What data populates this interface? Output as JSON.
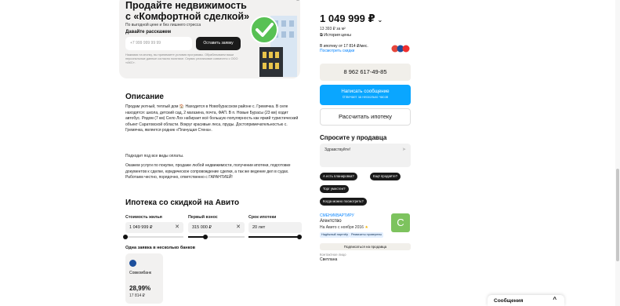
{
  "promo": {
    "title": "Продайте недвижимость с «Комфортной сделкой»",
    "subtitle": "По выгодной цене и без лишнего стресса",
    "cta": "Давайте расскажем",
    "phone_placeholder": "+7 999 999 99 99",
    "submit": "Оставить заявку",
    "legal": "Нажимая на кнопку, вы принимаете условия программы. Обрабатываем ваши персональные данные согласно политике. Сервис реализован совместно с ООО «АКС»."
  },
  "description": {
    "title": "Описание",
    "p1": "Продам уютный, теплый дом 🏠 Находится в Новобурасском районе с. Гремячка. В селе находятся: школа, детский сад, 2 магазина, почта, ФАП. В п. Новые Бурасы (23 км) ходит автобус. Рядом (7 км) Село Лох набирает всё большую популярность как яркий туристический объект Саратовской области. Вокруг красивые леса, пруды. Достопримечательностью с. Гремячка, является родник «Плачущая Стена».",
    "p2": "Подходит под все виды оплаты.",
    "p3": "Окажем услуги по покупке, продаже любой недвижимости, получении ипотеки, подготовке документов к сделке, юридическое сопровождение сделки, а так же ведение дел в судах. Работаем честно, порядочно, ответственно с ГАРАНТИЕЙ!"
  },
  "calculator": {
    "title": "Ипотека со скидкой на Авито",
    "price_label": "Стоимость жилья",
    "price_value": "1 049 999 ₽",
    "down_label": "Первый взнос",
    "down_value": "315 000 ₽",
    "term_label": "Срок ипотеки",
    "term_value": "20 лет",
    "price_slider": 0.0,
    "down_slider": 0.3,
    "term_slider": 0.95,
    "banks_title": "Одна заявка в несколько банков",
    "bank": {
      "name": "Совкомбанк",
      "rate": "28,99%",
      "payment": "17 814 ₽"
    }
  },
  "sidebar": {
    "price": "1 049 999 ₽",
    "price_per_m2": "13 393 ₽ за м²",
    "price_history": "История цены",
    "mortgage_text": "В ипотеку от 17 814 ₽/мес.",
    "mortgage_link": "Посмотреть скидки",
    "phone": "8 962 617-49-85",
    "write_message": "Написать сообщение",
    "write_message_sub": "Отвечает за несколько часов",
    "calc_mortgage": "Рассчитать ипотеку",
    "ask_title": "Спросите у продавца",
    "ask_placeholder": "Здравствуйте!",
    "chips": [
      "А есть планировка?",
      "Ещё продаёте?",
      "Торг уместен?",
      "Когда можно посмотреть?"
    ],
    "seller_name": "СМЕНИКВАРТИРУ",
    "seller_type": "Агентство",
    "seller_since": "На Авито с ноября 2016",
    "badges": [
      "Надёжный партнёр",
      "Реквизиты проверены"
    ],
    "avatar_letter": "С",
    "subscribe": "Подписаться на продавца",
    "contact_label": "Контактное лицо",
    "contact_name": "Светлана"
  },
  "messages": {
    "label": "Сообщения"
  },
  "colors": {
    "accent": "#0aa6ff",
    "link": "#0a86ff",
    "avatar": "#7dc35e"
  }
}
